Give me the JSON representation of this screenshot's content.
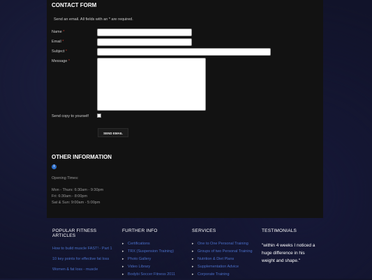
{
  "contact": {
    "title": "CONTACT FORM",
    "intro": "Send an email. All fields with an * are required.",
    "name_label": "Name",
    "email_label": "Email",
    "subject_label": "Subject",
    "message_label": "Message",
    "required_mark": "*",
    "copy_label": "Send copy to yourself",
    "send_label": "SEND EMAIL"
  },
  "other": {
    "title": "OTHER INFORMATION",
    "info_icon": "info-icon",
    "opening": "Opening Times:",
    "hours": [
      "Mon - Thurs: 6:30am - 9:30pm",
      "Fri: 6:30am - 8:00pm",
      "Sat & Sun: 9:00am - 5:00pm"
    ]
  },
  "footer": {
    "articles": {
      "title": "POPULAR FITNESS ARTICLES",
      "items": [
        "How to build muscle FAST! - Part 1",
        "10 key points for effective fat loss",
        "Women & fat loss - muscle"
      ]
    },
    "further": {
      "title": "FURTHER INFO",
      "items": [
        "Certifications",
        "TRX (Suspension Training)",
        "Photo Gallery",
        "Video Library",
        "Bodybi Soccer Fitness 2011"
      ]
    },
    "services": {
      "title": "SERVICES",
      "items": [
        "One to One Personal Training",
        "Groups of two Personal Training",
        "Nutrition & Diet Plans",
        "Supplementation Advice",
        "Corporate Training"
      ]
    },
    "testimonials": {
      "title": "TESTIMONIALS",
      "quote": "\"within 4 weeks I noticed a huge difference in his weight and shape.\""
    }
  },
  "colors": {
    "panel": "#121212",
    "link": "#4a6fc9",
    "required": "#c0392b"
  }
}
